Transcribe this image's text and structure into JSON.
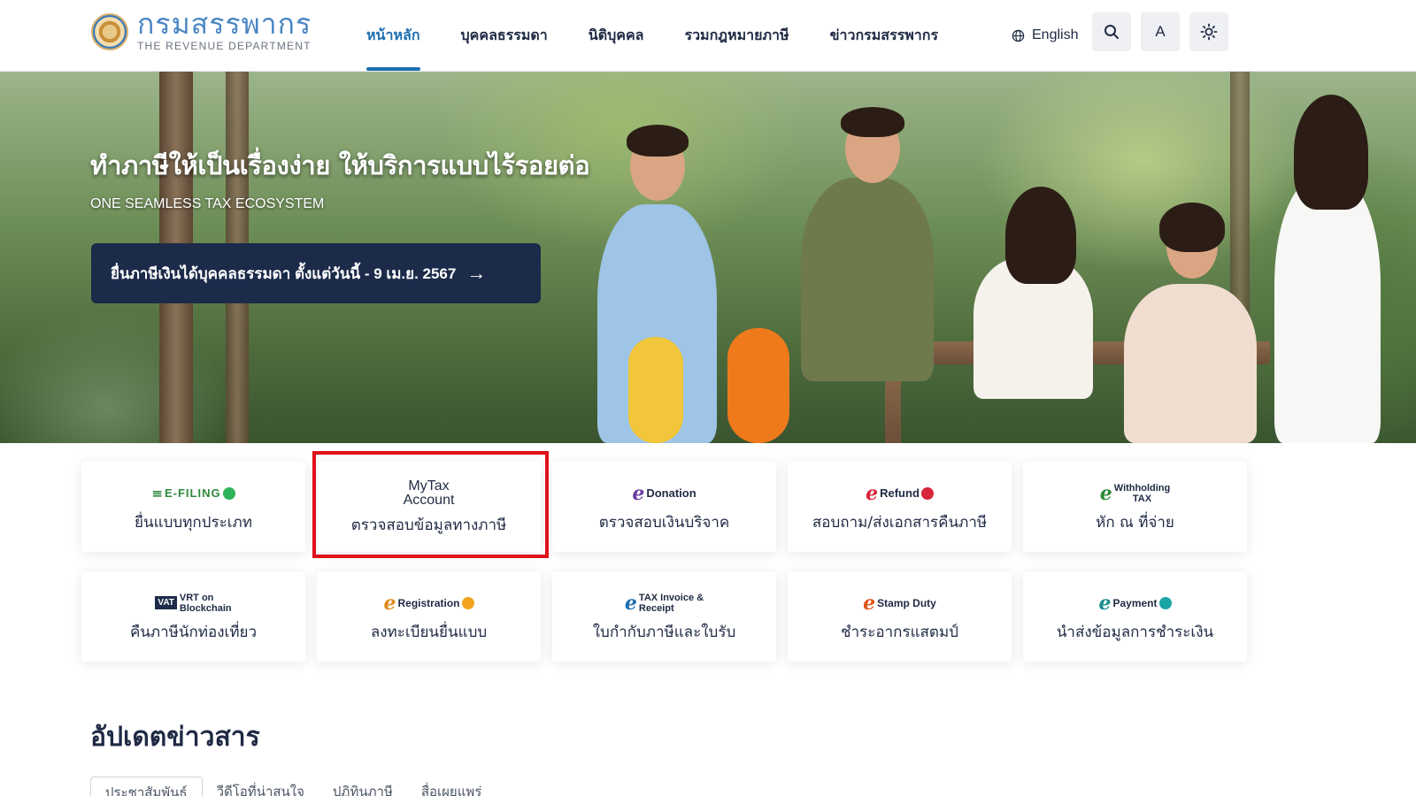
{
  "header": {
    "logo_thai": "กรมสรรพากร",
    "logo_english": "THE REVENUE DEPARTMENT",
    "nav": [
      {
        "label": "หน้าหลัก",
        "active": true
      },
      {
        "label": "บุคคลธรรมดา",
        "active": false
      },
      {
        "label": "นิติบุคคล",
        "active": false
      },
      {
        "label": "รวมกฎหมายภาษี",
        "active": false
      },
      {
        "label": "ข่าวกรมสรรพากร",
        "active": false
      }
    ],
    "language": "English",
    "font_size_button": "A",
    "icons": [
      "globe-icon",
      "search-icon",
      "sun-icon"
    ]
  },
  "hero": {
    "title": "ทำภาษีให้เป็นเรื่องง่าย ให้บริการแบบไร้รอยต่อ",
    "subtitle": "ONE SEAMLESS TAX ECOSYSTEM",
    "cta": "ยื่นภาษีเงินได้บุคคลธรรมดา ตั้งแต่วันนี้ - 9 เม.ย. 2567",
    "cta_icon": "arrow-right-icon"
  },
  "services": [
    {
      "logo": "E-FILING",
      "label": "ยื่นแบบทุกประเภท"
    },
    {
      "logo_line1": "MyTax",
      "logo_line2": "Account",
      "label": "ตรวจสอบข้อมูลทางภาษี"
    },
    {
      "logo": "Donation",
      "label": "ตรวจสอบเงินบริจาค"
    },
    {
      "logo": "Refund",
      "label": "สอบถาม/ส่งเอกสารคืนภาษี"
    },
    {
      "logo_line1": "Withholding",
      "logo_line2": "TAX",
      "label": "หัก ณ ที่จ่าย"
    },
    {
      "logo_line1": "VRT on",
      "logo_line2": "Blockchain",
      "badge": "VAT",
      "label": "คืนภาษีนักท่องเที่ยว"
    },
    {
      "logo": "Registration",
      "label": "ลงทะเบียนยื่นแบบ"
    },
    {
      "logo_line1": "TAX Invoice &",
      "logo_line2": "Receipt",
      "label": "ใบกำกับภาษีและใบรับ"
    },
    {
      "logo": "Stamp Duty",
      "label": "ชำระอากรแสตมป์"
    },
    {
      "logo": "Payment",
      "label": "นำส่งข้อมูลการชำระเงิน"
    }
  ],
  "news": {
    "title": "อัปเดตข่าวสาร",
    "tabs": [
      "ประชาสัมพันธ์",
      "วีดีโอที่น่าสนใจ",
      "ปฏิทินภาษี",
      "สื่อเผยแพร่"
    ]
  },
  "colors": {
    "primary": "#1e6fb1",
    "navy": "#1c2b4a",
    "highlight": "#e0121a"
  }
}
